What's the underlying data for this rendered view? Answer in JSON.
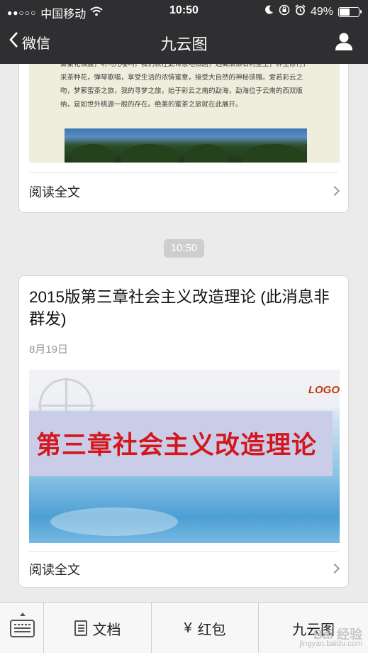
{
  "status_bar": {
    "signal_dots": "●●○○○",
    "carrier": "中国移动",
    "time": "10:50",
    "battery": "49%",
    "battery_level": 0.49,
    "icons": [
      "wifi-icon",
      "moon-icon",
      "orientation-lock-icon",
      "alarm-icon",
      "battery-icon"
    ]
  },
  "nav": {
    "back_label": "微信",
    "title": "九云图",
    "right_icon": "person-icon"
  },
  "messages": {
    "card1": {
      "excerpt": "雾繁花锦簇，听鸟儿嘤鸣，我们就在此诗意地栖居，远离滚滚名利尘土，养生修行，采茶种花，弹琴歌唱，享受生活的浓情蜜意，接受大自然的神秘馈赠。爱若彩云之吻，梦萦蜜茶之旅，我的寻梦之旅，始于彩云之南的勐海，勐海位于云南的西双版纳，是如世外桃源一般的存在。绝美的蜜茶之旅就在此展开。",
      "read_more": "阅读全文"
    },
    "time_pill": "10:50",
    "card2": {
      "title": "2015版第三章社会主义改造理论 (此消息非群发)",
      "date": "8月19日",
      "slide_logo": "LOGO",
      "slide_heading": "第三章社会主义改造理论",
      "read_more": "阅读全文"
    }
  },
  "toolbar": {
    "docs_label": "文档",
    "hongbao_symbol": "¥",
    "hongbao_label": "红包",
    "menu_label": "九云图"
  },
  "watermark": {
    "brand": "Bai 经验",
    "url": "jingyan.baidu.com"
  }
}
